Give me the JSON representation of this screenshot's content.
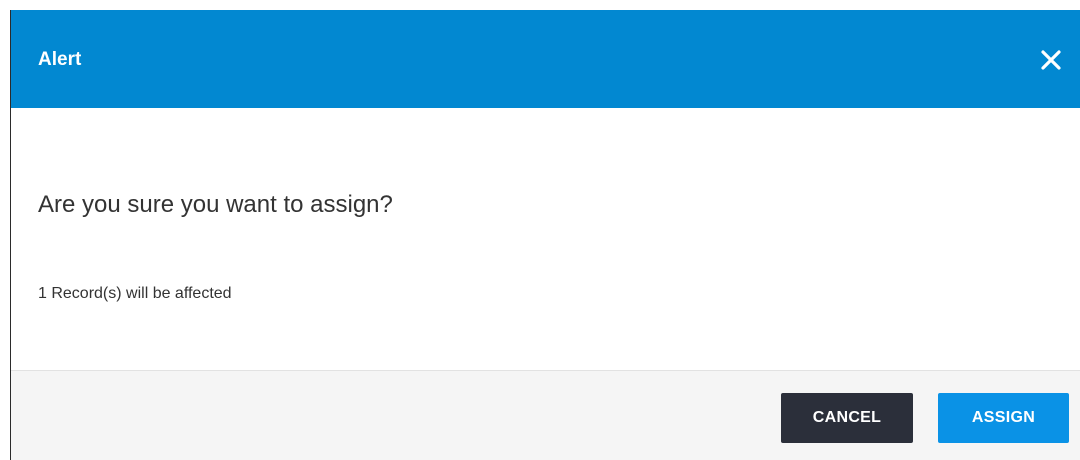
{
  "dialog": {
    "title": "Alert",
    "close_icon": "close-icon",
    "question": "Are you sure you want to assign?",
    "affected_text": "1 Record(s) will be affected"
  },
  "footer": {
    "cancel_label": "CANCEL",
    "assign_label": "ASSIGN"
  },
  "colors": {
    "header_bg": "#0288d1",
    "cancel_bg": "#2b2f3a",
    "assign_bg": "#0a92e6",
    "footer_bg": "#f5f5f5"
  }
}
